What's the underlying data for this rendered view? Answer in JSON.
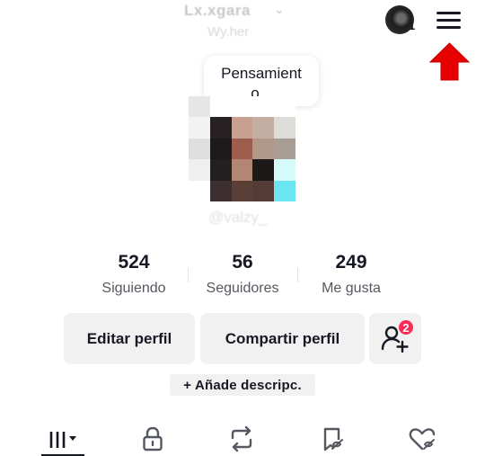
{
  "header": {
    "username": "Lx.xgara",
    "subtitle": "Wy.her",
    "account_switch_count": "1",
    "menu_icon": "hamburger-menu-icon",
    "annotation_arrow_color": "#e60000"
  },
  "profile": {
    "thought_bubble": "Pensamient o...",
    "handle": "@valzy_"
  },
  "stats": [
    {
      "value": "524",
      "label": "Siguiendo"
    },
    {
      "value": "56",
      "label": "Seguidores"
    },
    {
      "value": "249",
      "label": "Me gusta"
    }
  ],
  "actions": {
    "edit_label": "Editar perfil",
    "share_label": "Compartir perfil",
    "add_friends_badge": "2"
  },
  "bio": {
    "add_description": "+ Añade descripc."
  },
  "tabs": [
    {
      "icon": "videos-grid-icon",
      "active": true
    },
    {
      "icon": "lock-icon",
      "active": false
    },
    {
      "icon": "repost-icon",
      "active": false
    },
    {
      "icon": "favorites-icon",
      "active": false
    },
    {
      "icon": "liked-icon",
      "active": false
    }
  ],
  "colors": {
    "accent": "#fe2c55",
    "text": "#161823",
    "muted": "#555860",
    "button_bg": "#f1f1f2"
  }
}
